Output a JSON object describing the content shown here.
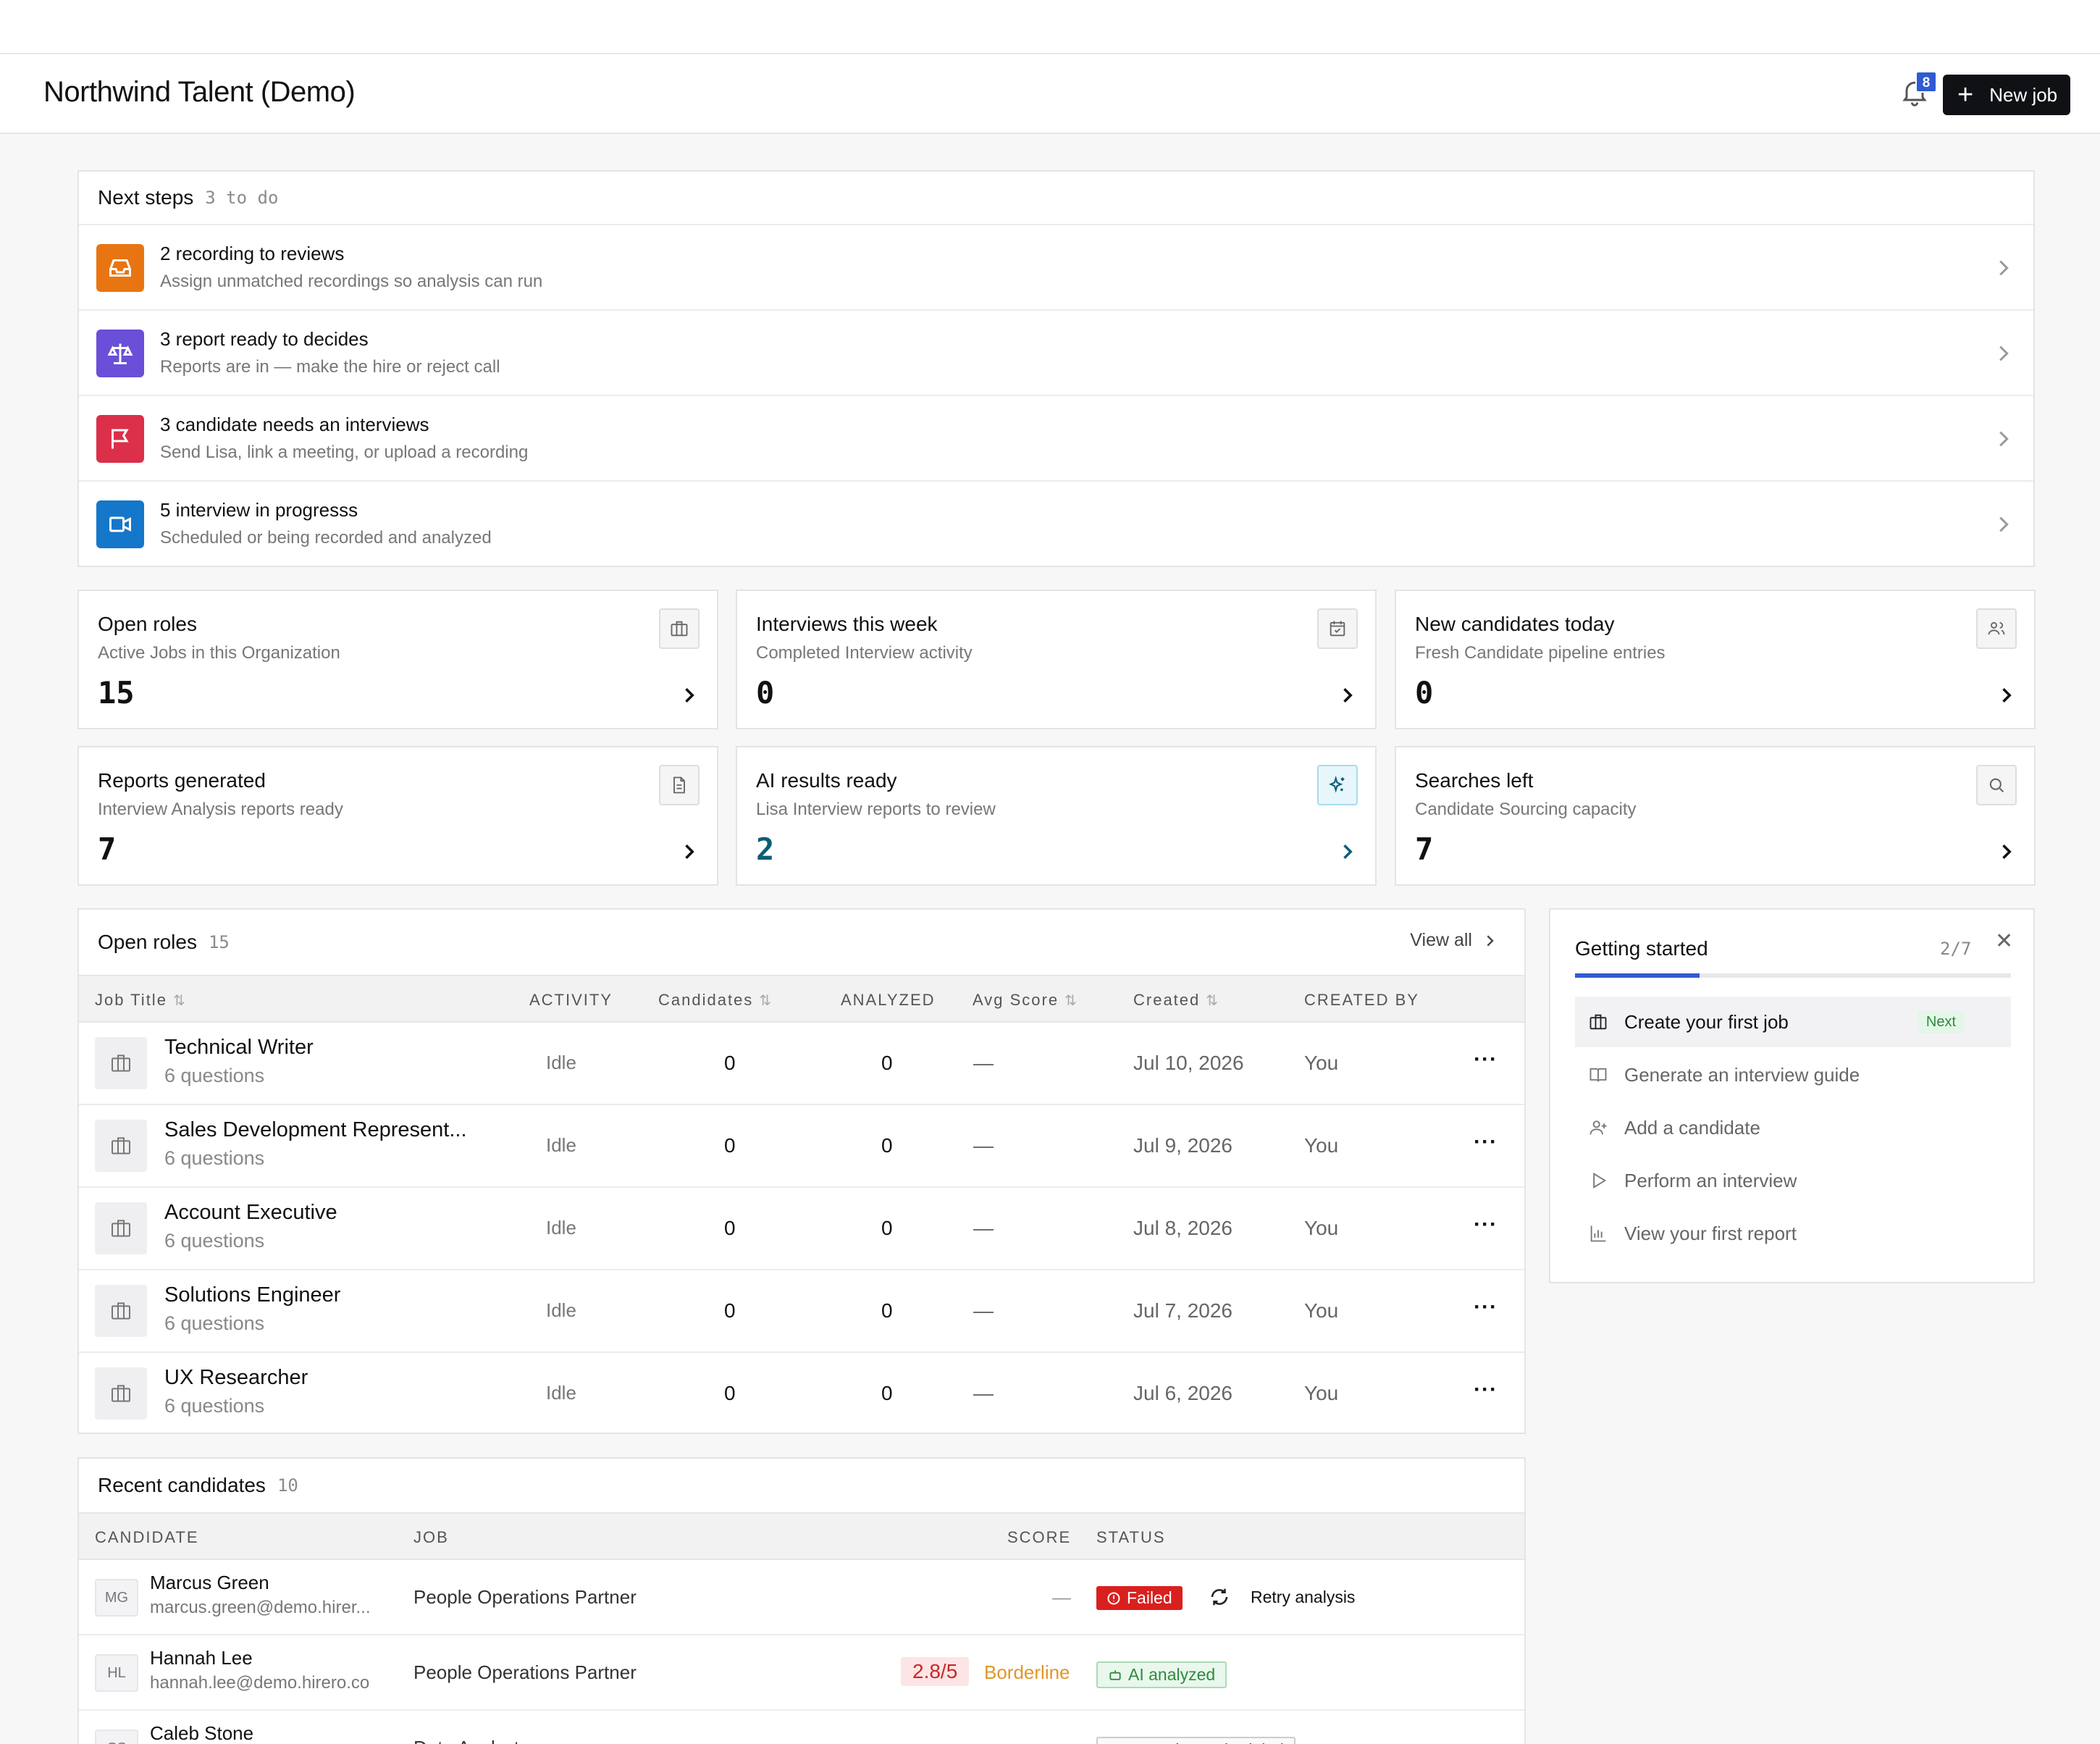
{
  "header": {
    "title": "Northwind Talent (Demo)",
    "notification_count": "8",
    "new_job_label": "New job"
  },
  "next_steps": {
    "title": "Next steps",
    "count": "3 to do",
    "items": [
      {
        "title": "2 recording to reviews",
        "subtitle": "Assign unmatched recordings so analysis can run",
        "icon": "inbox-icon",
        "color": "#e87511"
      },
      {
        "title": "3 report ready to decides",
        "subtitle": "Reports are in — make the hire or reject call",
        "icon": "scale-icon",
        "color": "#6a4fd8"
      },
      {
        "title": "3 candidate needs an interviews",
        "subtitle": "Send Lisa, link a meeting, or upload a recording",
        "icon": "flag-icon",
        "color": "#dc2f4a"
      },
      {
        "title": "5 interview in progresss",
        "subtitle": "Scheduled or being recorded and analyzed",
        "icon": "video-icon",
        "color": "#1577c9"
      }
    ]
  },
  "stats": [
    {
      "title": "Open roles",
      "subtitle": "Active Jobs in this Organization",
      "value": "15",
      "icon": "briefcase-icon"
    },
    {
      "title": "Interviews this week",
      "subtitle": "Completed Interview activity",
      "value": "0",
      "icon": "calendar-icon"
    },
    {
      "title": "New candidates today",
      "subtitle": "Fresh Candidate pipeline entries",
      "value": "0",
      "icon": "users-icon"
    },
    {
      "title": "Reports generated",
      "subtitle": "Interview Analysis reports ready",
      "value": "7",
      "icon": "document-icon"
    },
    {
      "title": "AI results ready",
      "subtitle": "Lisa Interview reports to review",
      "value": "2",
      "icon": "sparkle-icon",
      "accent": "#0b5e73"
    },
    {
      "title": "Searches left",
      "subtitle": "Candidate Sourcing capacity",
      "value": "7",
      "icon": "search-icon"
    }
  ],
  "open_roles": {
    "title": "Open roles",
    "count": "15",
    "view_all": "View all",
    "columns": [
      "Job Title",
      "ACTIVITY",
      "Candidates",
      "ANALYZED",
      "Avg Score",
      "Created",
      "CREATED BY"
    ],
    "rows": [
      {
        "title": "Technical Writer",
        "questions": "6 questions",
        "activity": "Idle",
        "candidates": "0",
        "analyzed": "0",
        "avg_score": "—",
        "created": "Jul 10, 2026",
        "created_by": "You"
      },
      {
        "title": "Sales Development Represent...",
        "questions": "6 questions",
        "activity": "Idle",
        "candidates": "0",
        "analyzed": "0",
        "avg_score": "—",
        "created": "Jul 9, 2026",
        "created_by": "You"
      },
      {
        "title": "Account Executive",
        "questions": "6 questions",
        "activity": "Idle",
        "candidates": "0",
        "analyzed": "0",
        "avg_score": "—",
        "created": "Jul 8, 2026",
        "created_by": "You"
      },
      {
        "title": "Solutions Engineer",
        "questions": "6 questions",
        "activity": "Idle",
        "candidates": "0",
        "analyzed": "0",
        "avg_score": "—",
        "created": "Jul 7, 2026",
        "created_by": "You"
      },
      {
        "title": "UX Researcher",
        "questions": "6 questions",
        "activity": "Idle",
        "candidates": "0",
        "analyzed": "0",
        "avg_score": "—",
        "created": "Jul 6, 2026",
        "created_by": "You"
      }
    ]
  },
  "getting_started": {
    "title": "Getting started",
    "progress": "2/7",
    "progress_fraction": 0.2857,
    "items": [
      {
        "label": "Create your first job",
        "badge": "Next",
        "icon": "briefcase-icon"
      },
      {
        "label": "Generate an interview guide",
        "icon": "book-icon"
      },
      {
        "label": "Add a candidate",
        "icon": "user-plus-icon"
      },
      {
        "label": "Perform an interview",
        "icon": "play-icon"
      },
      {
        "label": "View your first report",
        "icon": "bar-chart-icon"
      }
    ]
  },
  "recent": {
    "title": "Recent candidates",
    "count": "10",
    "columns": [
      "CANDIDATE",
      "JOB",
      "SCORE",
      "STATUS"
    ],
    "rows": [
      {
        "initials": "MG",
        "name": "Marcus Green",
        "email": "marcus.green@demo.hirer...",
        "job": "People Operations Partner",
        "score": "—",
        "status": "Failed",
        "action": "Retry analysis"
      },
      {
        "initials": "HL",
        "name": "Hannah Lee",
        "email": "hannah.lee@demo.hirero.co",
        "job": "People Operations Partner",
        "score": "2.8/5",
        "score_tag": "Borderline",
        "status": "AI analyzed"
      },
      {
        "initials": "CS",
        "name": "Caleb Stone",
        "email": "",
        "job": "Data Analyst",
        "score": "",
        "status": "No Interview Scheduled"
      }
    ]
  }
}
